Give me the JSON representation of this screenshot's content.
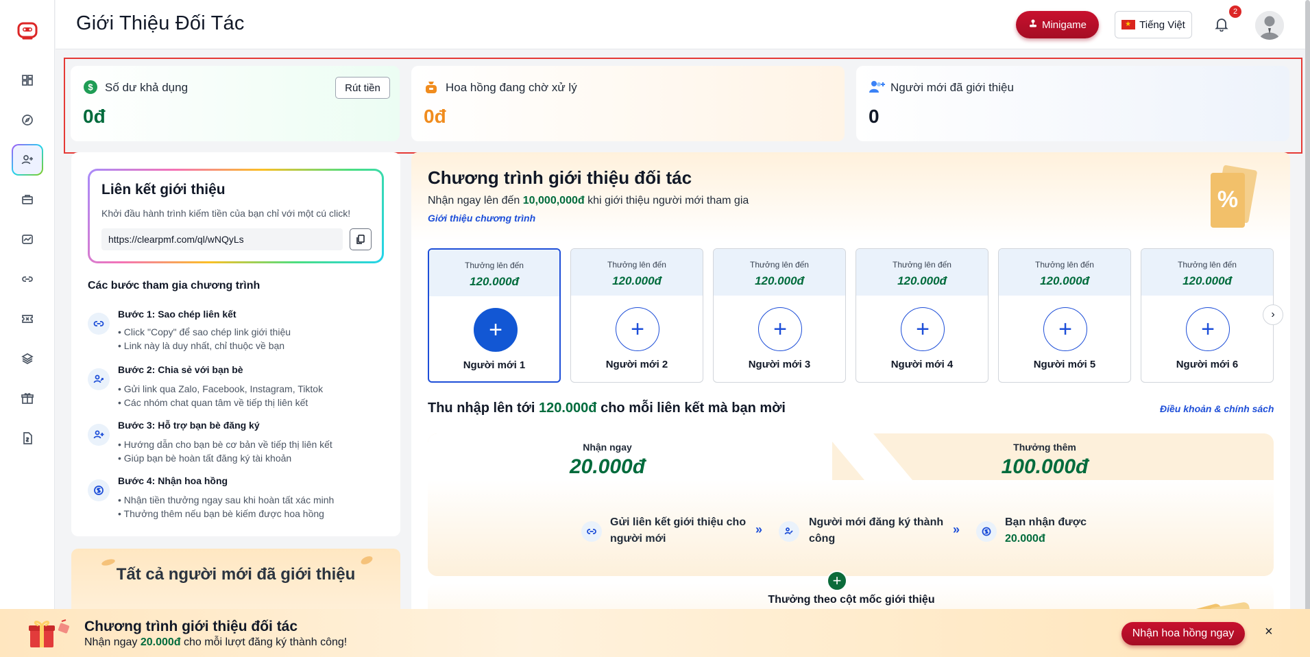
{
  "header": {
    "title": "Giới Thiệu Đối Tác",
    "minigame_label": "Minigame",
    "language_label": "Tiếng Việt",
    "notification_count": "2"
  },
  "sidebar": {
    "items": [
      "dashboard-icon",
      "compass-icon",
      "user-plus-icon",
      "briefcase-icon",
      "chart-icon",
      "link-icon",
      "ticket-icon",
      "layers-icon",
      "gift-icon",
      "document-icon"
    ],
    "active_index": 2
  },
  "stats": {
    "balance_label": "Số dư khả dụng",
    "balance_value": "0đ",
    "withdraw_label": "Rút tiền",
    "pending_label": "Hoa hồng đang chờ xử lý",
    "pending_value": "0đ",
    "referrals_label": "Người mới đã giới thiệu",
    "referrals_value": "0",
    "colors": {
      "balance": "#006b3c",
      "pending": "#f08c1e",
      "referrals": "#111827"
    }
  },
  "referral_link": {
    "title": "Liên kết giới thiệu",
    "subtitle": "Khởi đầu hành trình kiếm tiền của bạn chỉ với một cú click!",
    "url": "https://clearpmf.com/ql/wNQyLs"
  },
  "steps": {
    "title": "Các bước tham gia chương trình",
    "items": [
      {
        "title": "Bước 1: Sao chép liên kết",
        "lines": [
          "• Click \"Copy\" để sao chép link giới thiệu",
          "• Link này là duy nhất, chỉ thuộc về bạn"
        ]
      },
      {
        "title": "Bước 2: Chia sẻ với bạn bè",
        "lines": [
          "• Gửi link qua Zalo, Facebook, Instagram, Tiktok",
          "• Các nhóm chat quan tâm về tiếp thị liên kết"
        ]
      },
      {
        "title": "Bước 3: Hỗ trợ bạn bè đăng ký",
        "lines": [
          "• Hướng dẫn cho bạn bè cơ bản về tiếp thị liên kết",
          "• Giúp bạn bè hoàn tất đăng ký tài khoản"
        ]
      },
      {
        "title": "Bước 4: Nhận hoa hồng",
        "lines": [
          "• Nhận tiền thưởng ngay sau khi hoàn tất xác minh",
          "• Thưởng thêm nếu bạn bè kiếm được hoa hồng"
        ]
      }
    ]
  },
  "all_referrals_title": "Tất cả người mới đã giới thiệu",
  "program": {
    "title": "Chương trình giới thiệu đối tác",
    "subtitle_prefix": "Nhận ngay lên đến",
    "subtitle_amount": "10,000,000đ",
    "subtitle_suffix": "khi giới thiệu người mới tham gia",
    "intro_link": "Giới thiệu chương trình",
    "cards": [
      {
        "caption": "Thưởng lên đến",
        "amount": "120.000đ",
        "name": "Người mới 1"
      },
      {
        "caption": "Thưởng lên đến",
        "amount": "120.000đ",
        "name": "Người mới 2"
      },
      {
        "caption": "Thưởng lên đến",
        "amount": "120.000đ",
        "name": "Người mới 3"
      },
      {
        "caption": "Thưởng lên đến",
        "amount": "120.000đ",
        "name": "Người mới 4"
      },
      {
        "caption": "Thưởng lên đến",
        "amount": "120.000đ",
        "name": "Người mới 5"
      },
      {
        "caption": "Thưởng lên đến",
        "amount": "120.000đ",
        "name": "Người mới 6"
      }
    ]
  },
  "earnings": {
    "title_prefix": "Thu nhập lên tới",
    "title_amount": "120.000đ",
    "title_suffix": "cho mỗi liên kết mà bạn mời",
    "terms_link": "Điều khoản & chính sách",
    "now_label": "Nhận ngay",
    "now_amount": "20.000đ",
    "bonus_label": "Thưởng thêm",
    "bonus_amount": "100.000đ",
    "flow": [
      {
        "text_1": "Gửi liên kết giới thiệu cho",
        "text_2": "người mới"
      },
      {
        "text_1": "Người mới đăng ký thành",
        "text_2": "công"
      },
      {
        "text_1": "Bạn nhận được",
        "text_2": "20.000đ"
      }
    ],
    "milestone_title": "Thưởng theo cột mốc giới thiệu"
  },
  "banner": {
    "title": "Chương trình giới thiệu đối tác",
    "sub_prefix": "Nhận ngay",
    "sub_amount": "20.000đ",
    "sub_suffix": "cho mỗi lượt đăng ký thành công!",
    "button": "Nhận hoa hồng ngay",
    "close": "×"
  }
}
